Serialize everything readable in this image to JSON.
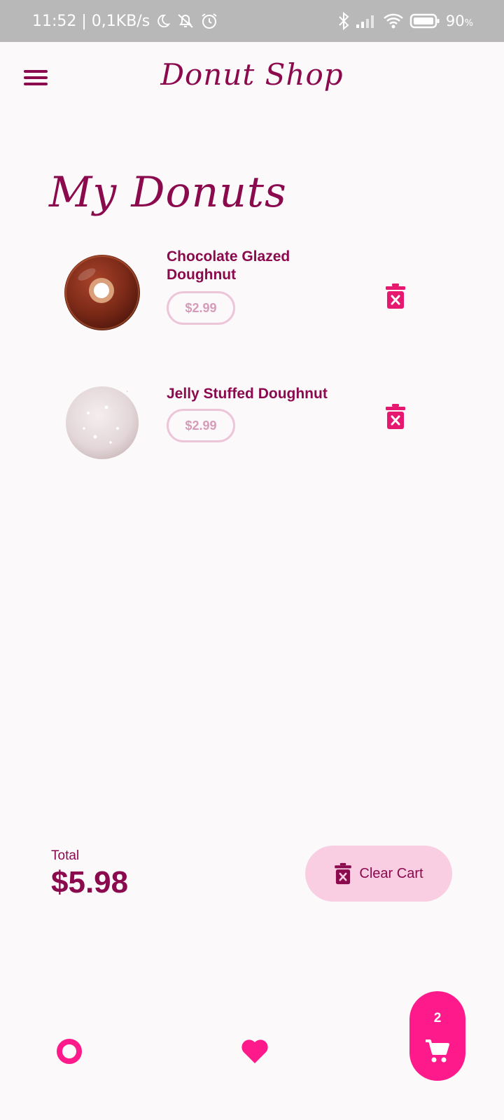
{
  "status_bar": {
    "time_speed": "11:52 | 0,1KB/s",
    "battery": "90",
    "battery_unit": "%"
  },
  "app_bar": {
    "title": "Donut Shop",
    "menu_icon": "hamburger-menu-icon"
  },
  "page": {
    "heading": "My Donuts"
  },
  "cart": {
    "items": [
      {
        "name": "Chocolate Glazed Doughnut",
        "price": "$2.99",
        "image": "chocolate-glazed-donut",
        "remove_icon": "trash-x-icon"
      },
      {
        "name": "Jelly Stuffed Doughnut",
        "price": "$2.99",
        "image": "powdered-jelly-donut",
        "remove_icon": "trash-x-icon"
      }
    ],
    "total_label": "Total",
    "total_value": "$5.98",
    "clear_label": "Clear Cart",
    "clear_icon": "trash-x-icon"
  },
  "bottom_nav": {
    "home_icon": "donut-ring-icon",
    "favorites_icon": "heart-icon",
    "cart_icon": "cart-icon",
    "cart_count": "2"
  },
  "colors": {
    "primary": "#8b0a4e",
    "accent": "#ff1a8c",
    "accent_soft": "#f9cde2",
    "price_text": "#d69bb9",
    "background": "#fbf9fa"
  }
}
